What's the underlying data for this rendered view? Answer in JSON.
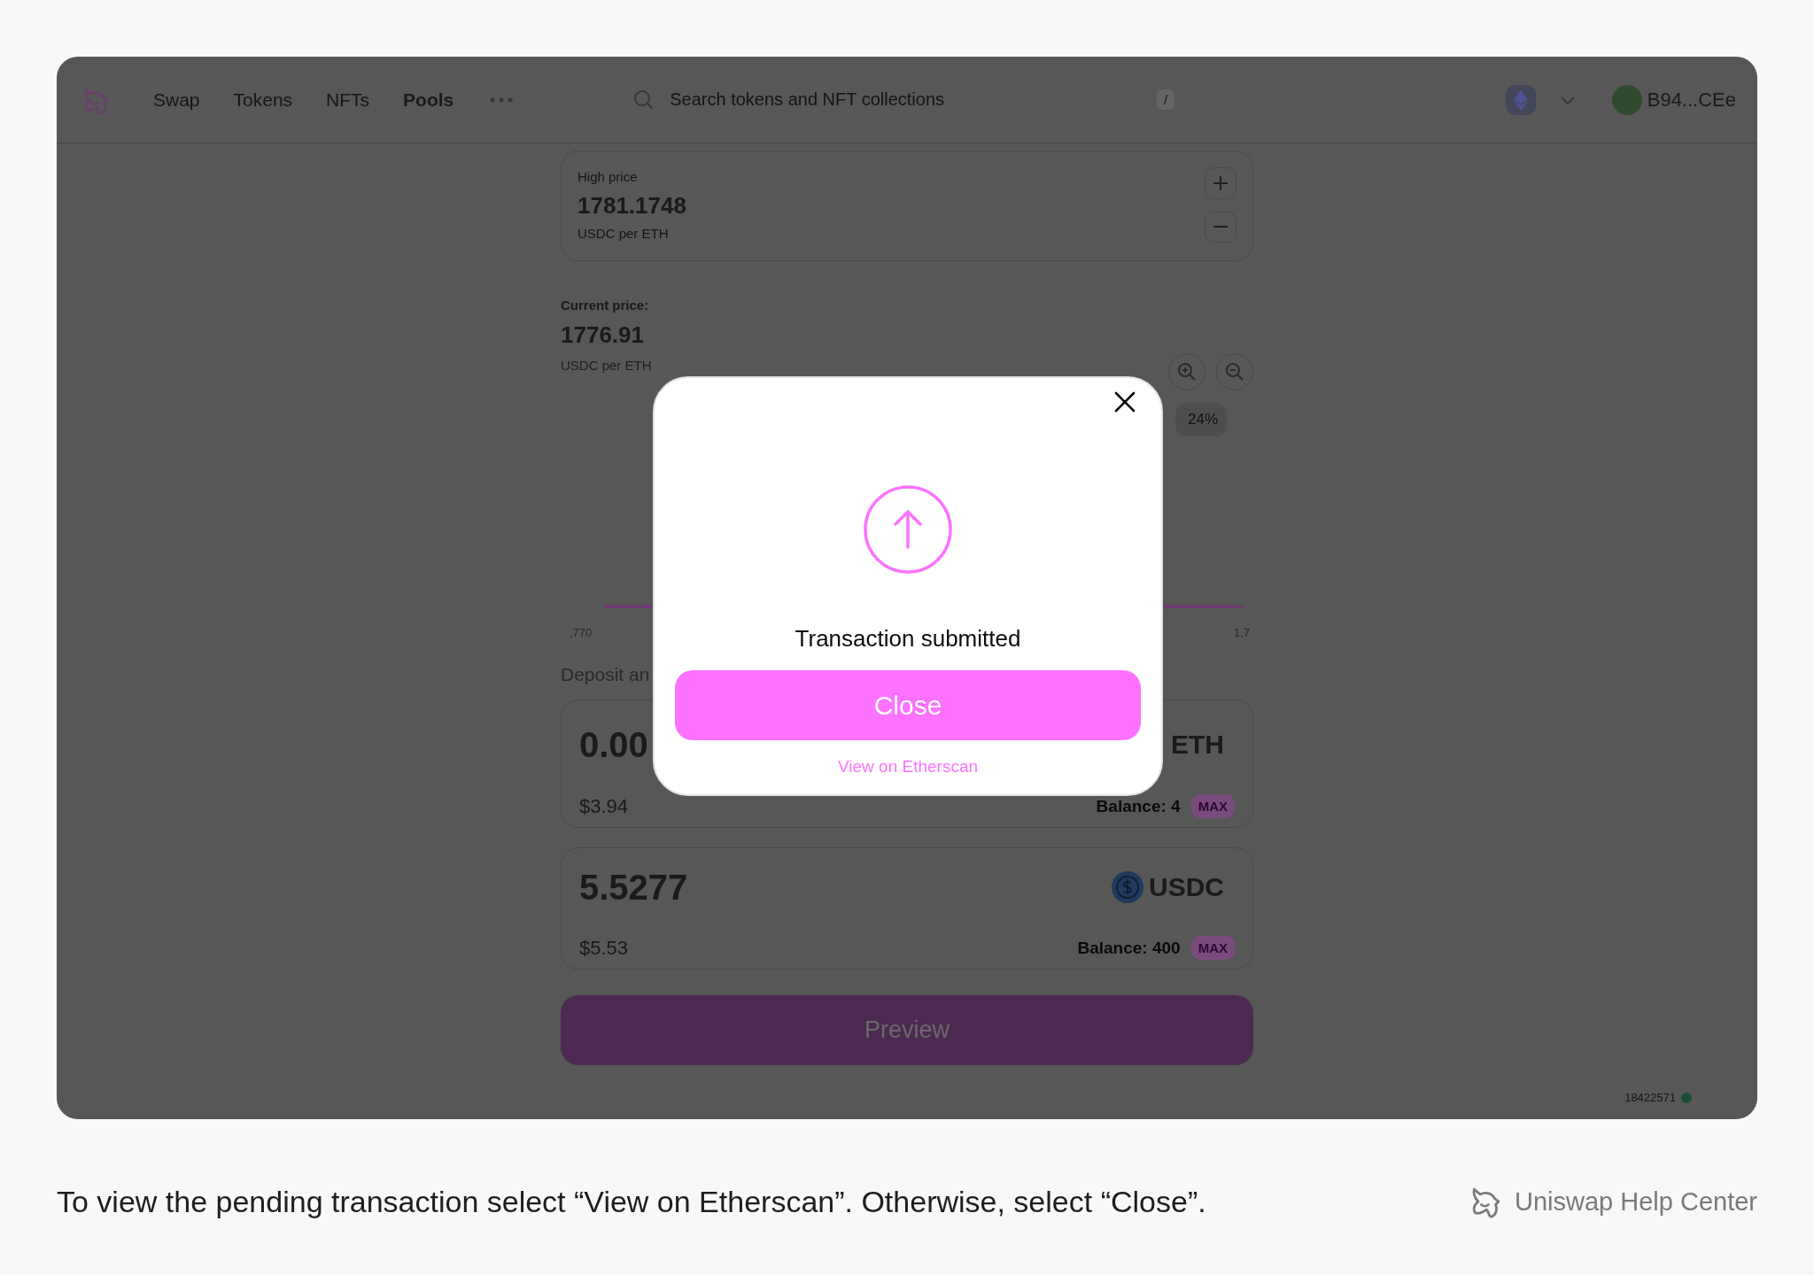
{
  "nav": {
    "tabs": [
      {
        "label": "Swap",
        "selected": false
      },
      {
        "label": "Tokens",
        "selected": false
      },
      {
        "label": "NFTs",
        "selected": false
      },
      {
        "label": "Pools",
        "selected": true
      }
    ],
    "search": {
      "placeholder": "Search tokens and NFT collections",
      "shortcut": "/"
    },
    "account": "B94...CEe"
  },
  "high_price": {
    "label": "High price",
    "value": "1781.1748",
    "unit": "USDC per ETH"
  },
  "current_price": {
    "label": "Current price:",
    "value": "1776.91",
    "unit": "USDC per ETH"
  },
  "range_chip": "24%",
  "axis_labels": [
    ",770",
    "1,7"
  ],
  "deposit_heading": "Deposit an",
  "deposits": [
    {
      "amount": "0.00",
      "token": "ETH",
      "usd": "$3.94",
      "balance": "Balance: 4",
      "max": "MAX",
      "kind": "eth"
    },
    {
      "amount": "5.5277",
      "token": "USDC",
      "usd": "$5.53",
      "balance": "Balance: 400",
      "max": "MAX",
      "kind": "usdc"
    }
  ],
  "preview_button": "Preview",
  "block_number": "18422571",
  "modal": {
    "title": "Transaction submitted",
    "button": "Close",
    "link": "View on Etherscan"
  },
  "caption": "To view the pending transaction select “View on Etherscan”. Otherwise, select “Close”.",
  "brand": "Uniswap Help Center"
}
